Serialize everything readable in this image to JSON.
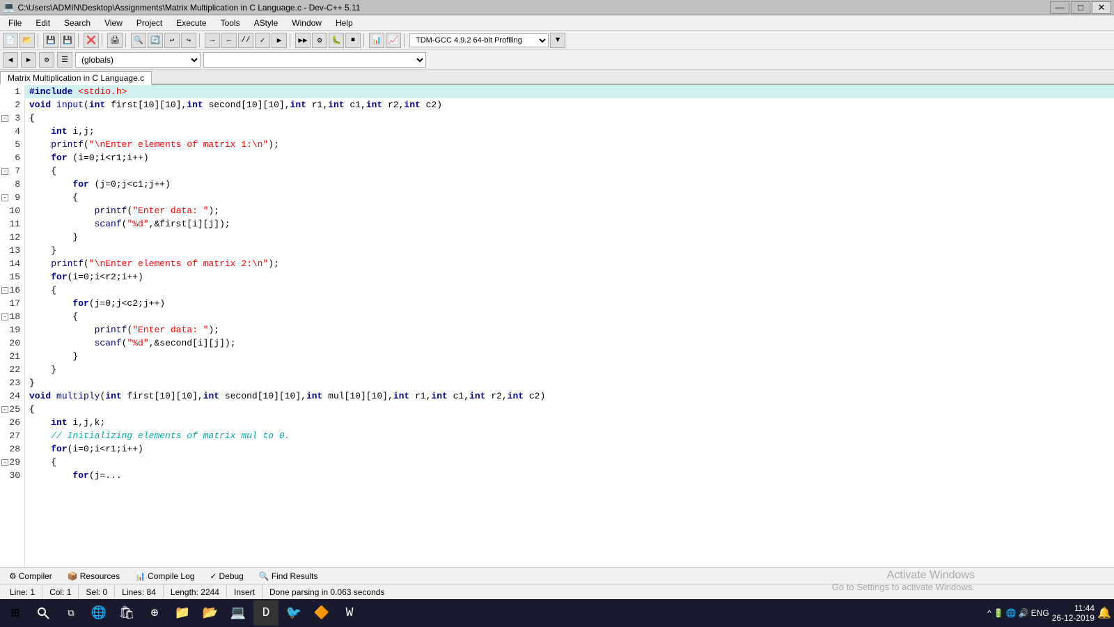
{
  "titlebar": {
    "title": "C:\\Users\\ADMIN\\Desktop\\Assignments\\Matrix Multiplication in C Language.c - Dev-C++ 5.11",
    "min_label": "—",
    "max_label": "□",
    "close_label": "✕"
  },
  "menu": {
    "items": [
      "File",
      "Edit",
      "Search",
      "View",
      "Project",
      "Execute",
      "Tools",
      "AStyle",
      "Window",
      "Help"
    ]
  },
  "toolbar": {
    "compiler_label": "TDM-GCC 4.9.2 64-bit Profiling",
    "scope_label": "(globals)",
    "func_label": ""
  },
  "tab": {
    "label": "Matrix Multiplication in C Language.c"
  },
  "code_lines": [
    {
      "num": 1,
      "highlighted": true,
      "tokens": [
        {
          "cls": "kw",
          "t": "#include"
        },
        {
          "cls": "plain",
          "t": " "
        },
        {
          "cls": "str",
          "t": "<stdio.h>"
        }
      ]
    },
    {
      "num": 2,
      "highlighted": false,
      "tokens": [
        {
          "cls": "kw",
          "t": "void"
        },
        {
          "cls": "plain",
          "t": " "
        },
        {
          "cls": "func",
          "t": "input"
        },
        {
          "cls": "plain",
          "t": "("
        },
        {
          "cls": "kw",
          "t": "int"
        },
        {
          "cls": "plain",
          "t": " first[10][10],"
        },
        {
          "cls": "kw",
          "t": "int"
        },
        {
          "cls": "plain",
          "t": " second[10][10],"
        },
        {
          "cls": "kw",
          "t": "int"
        },
        {
          "cls": "plain",
          "t": " r1,"
        },
        {
          "cls": "kw",
          "t": "int"
        },
        {
          "cls": "plain",
          "t": " c1,"
        },
        {
          "cls": "kw",
          "t": "int"
        },
        {
          "cls": "plain",
          "t": " r2,"
        },
        {
          "cls": "kw",
          "t": "int"
        },
        {
          "cls": "plain",
          "t": " c2)"
        }
      ]
    },
    {
      "num": 3,
      "highlighted": false,
      "fold": "-",
      "tokens": [
        {
          "cls": "plain",
          "t": "{"
        }
      ]
    },
    {
      "num": 4,
      "highlighted": false,
      "tokens": [
        {
          "cls": "plain",
          "t": "    "
        },
        {
          "cls": "kw",
          "t": "int"
        },
        {
          "cls": "plain",
          "t": " i,j;"
        }
      ]
    },
    {
      "num": 5,
      "highlighted": false,
      "tokens": [
        {
          "cls": "plain",
          "t": "    "
        },
        {
          "cls": "func",
          "t": "printf"
        },
        {
          "cls": "plain",
          "t": "("
        },
        {
          "cls": "str",
          "t": "\"\\nEnter elements of matrix 1:\\n\""
        },
        {
          "cls": "plain",
          "t": ");"
        }
      ]
    },
    {
      "num": 6,
      "highlighted": false,
      "tokens": [
        {
          "cls": "plain",
          "t": "    "
        },
        {
          "cls": "kw",
          "t": "for"
        },
        {
          "cls": "plain",
          "t": " (i=0;i<r1;i++)"
        }
      ]
    },
    {
      "num": 7,
      "highlighted": false,
      "fold": "-",
      "tokens": [
        {
          "cls": "plain",
          "t": "    {"
        }
      ]
    },
    {
      "num": 8,
      "highlighted": false,
      "tokens": [
        {
          "cls": "plain",
          "t": "        "
        },
        {
          "cls": "kw",
          "t": "for"
        },
        {
          "cls": "plain",
          "t": " (j=0;j<c1;j++)"
        }
      ]
    },
    {
      "num": 9,
      "highlighted": false,
      "fold": "-",
      "tokens": [
        {
          "cls": "plain",
          "t": "        {"
        }
      ]
    },
    {
      "num": 10,
      "highlighted": false,
      "tokens": [
        {
          "cls": "plain",
          "t": "            "
        },
        {
          "cls": "func",
          "t": "printf"
        },
        {
          "cls": "plain",
          "t": "("
        },
        {
          "cls": "str",
          "t": "\"Enter data: \""
        },
        {
          "cls": "plain",
          "t": ");"
        }
      ]
    },
    {
      "num": 11,
      "highlighted": false,
      "tokens": [
        {
          "cls": "plain",
          "t": "            "
        },
        {
          "cls": "func",
          "t": "scanf"
        },
        {
          "cls": "plain",
          "t": "("
        },
        {
          "cls": "str",
          "t": "\"%d\""
        },
        {
          "cls": "plain",
          "t": ",&first[i][j]);"
        }
      ]
    },
    {
      "num": 12,
      "highlighted": false,
      "tokens": [
        {
          "cls": "plain",
          "t": "        }"
        }
      ]
    },
    {
      "num": 13,
      "highlighted": false,
      "tokens": [
        {
          "cls": "plain",
          "t": "    }"
        }
      ]
    },
    {
      "num": 14,
      "highlighted": false,
      "tokens": [
        {
          "cls": "plain",
          "t": "    "
        },
        {
          "cls": "func",
          "t": "printf"
        },
        {
          "cls": "plain",
          "t": "("
        },
        {
          "cls": "str",
          "t": "\"\\nEnter elements of matrix 2:\\n\""
        },
        {
          "cls": "plain",
          "t": ");"
        }
      ]
    },
    {
      "num": 15,
      "highlighted": false,
      "tokens": [
        {
          "cls": "plain",
          "t": "    "
        },
        {
          "cls": "kw",
          "t": "for"
        },
        {
          "cls": "plain",
          "t": "(i=0;i<r2;i++)"
        }
      ]
    },
    {
      "num": 16,
      "highlighted": false,
      "fold": "-",
      "tokens": [
        {
          "cls": "plain",
          "t": "    {"
        }
      ]
    },
    {
      "num": 17,
      "highlighted": false,
      "tokens": [
        {
          "cls": "plain",
          "t": "        "
        },
        {
          "cls": "kw",
          "t": "for"
        },
        {
          "cls": "plain",
          "t": "(j=0;j<c2;j++)"
        }
      ]
    },
    {
      "num": 18,
      "highlighted": false,
      "fold": "-",
      "tokens": [
        {
          "cls": "plain",
          "t": "        {"
        }
      ]
    },
    {
      "num": 19,
      "highlighted": false,
      "tokens": [
        {
          "cls": "plain",
          "t": "            "
        },
        {
          "cls": "func",
          "t": "printf"
        },
        {
          "cls": "plain",
          "t": "("
        },
        {
          "cls": "str",
          "t": "\"Enter data: \""
        },
        {
          "cls": "plain",
          "t": ");"
        }
      ]
    },
    {
      "num": 20,
      "highlighted": false,
      "tokens": [
        {
          "cls": "plain",
          "t": "            "
        },
        {
          "cls": "func",
          "t": "scanf"
        },
        {
          "cls": "plain",
          "t": "("
        },
        {
          "cls": "str",
          "t": "\"%d\""
        },
        {
          "cls": "plain",
          "t": ",&second[i][j]);"
        }
      ]
    },
    {
      "num": 21,
      "highlighted": false,
      "tokens": [
        {
          "cls": "plain",
          "t": "        }"
        }
      ]
    },
    {
      "num": 22,
      "highlighted": false,
      "tokens": [
        {
          "cls": "plain",
          "t": "    }"
        }
      ]
    },
    {
      "num": 23,
      "highlighted": false,
      "tokens": [
        {
          "cls": "plain",
          "t": "}"
        }
      ]
    },
    {
      "num": 24,
      "highlighted": false,
      "tokens": [
        {
          "cls": "kw",
          "t": "void"
        },
        {
          "cls": "plain",
          "t": " "
        },
        {
          "cls": "func",
          "t": "multiply"
        },
        {
          "cls": "plain",
          "t": "("
        },
        {
          "cls": "kw",
          "t": "int"
        },
        {
          "cls": "plain",
          "t": " first[10][10],"
        },
        {
          "cls": "kw",
          "t": "int"
        },
        {
          "cls": "plain",
          "t": " second[10][10],"
        },
        {
          "cls": "kw",
          "t": "int"
        },
        {
          "cls": "plain",
          "t": " mul[10][10],"
        },
        {
          "cls": "kw",
          "t": "int"
        },
        {
          "cls": "plain",
          "t": " r1,"
        },
        {
          "cls": "kw",
          "t": "int"
        },
        {
          "cls": "plain",
          "t": " c1,"
        },
        {
          "cls": "kw",
          "t": "int"
        },
        {
          "cls": "plain",
          "t": " r2,"
        },
        {
          "cls": "kw",
          "t": "int"
        },
        {
          "cls": "plain",
          "t": " c2)"
        }
      ]
    },
    {
      "num": 25,
      "highlighted": false,
      "fold": "-",
      "tokens": [
        {
          "cls": "plain",
          "t": "{"
        }
      ]
    },
    {
      "num": 26,
      "highlighted": false,
      "tokens": [
        {
          "cls": "plain",
          "t": "    "
        },
        {
          "cls": "kw",
          "t": "int"
        },
        {
          "cls": "plain",
          "t": " i,j,k;"
        }
      ]
    },
    {
      "num": 27,
      "highlighted": false,
      "tokens": [
        {
          "cls": "plain",
          "t": "    "
        },
        {
          "cls": "comment",
          "t": "// Initializing elements of matrix mul to 0."
        }
      ]
    },
    {
      "num": 28,
      "highlighted": false,
      "tokens": [
        {
          "cls": "plain",
          "t": "    "
        },
        {
          "cls": "kw",
          "t": "for"
        },
        {
          "cls": "plain",
          "t": "(i=0;i<r1;i++)"
        }
      ]
    },
    {
      "num": 29,
      "highlighted": false,
      "fold": "-",
      "tokens": [
        {
          "cls": "plain",
          "t": "    {"
        }
      ]
    },
    {
      "num": 30,
      "highlighted": false,
      "tokens": [
        {
          "cls": "plain",
          "t": "        "
        },
        {
          "cls": "kw",
          "t": "for"
        },
        {
          "cls": "plain",
          "t": "(j=..."
        }
      ]
    }
  ],
  "status": {
    "line_label": "Line:",
    "line_val": "1",
    "col_label": "Col:",
    "col_val": "1",
    "sel_label": "Sel:",
    "sel_val": "0",
    "lines_label": "Lines:",
    "lines_val": "84",
    "length_label": "Length:",
    "length_val": "2244",
    "insert_label": "Insert",
    "msg": "Done parsing in 0.063 seconds"
  },
  "bottom_tabs": [
    {
      "icon": "⚙",
      "label": "Compiler"
    },
    {
      "icon": "📦",
      "label": "Resources"
    },
    {
      "icon": "📊",
      "label": "Compile Log"
    },
    {
      "icon": "✓",
      "label": "Debug"
    },
    {
      "icon": "🔍",
      "label": "Find Results"
    }
  ],
  "activate_msg": {
    "line1": "Activate Windows",
    "line2": "Go to Settings to activate Windows."
  },
  "taskbar": {
    "time": "11:44",
    "date": "26-12-2019",
    "lang": "ENG"
  }
}
